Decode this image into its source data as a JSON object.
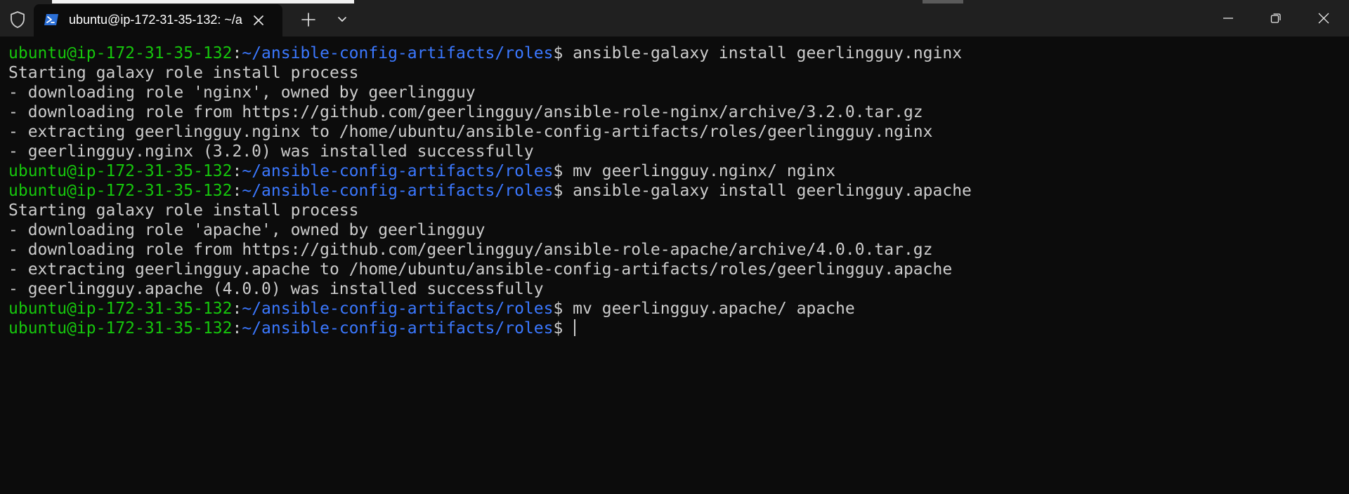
{
  "window": {
    "tab_title": "ubuntu@ip-172-31-35-132: ~/a",
    "controls": {
      "minimize": "minimize",
      "maximize": "restore",
      "close": "close"
    }
  },
  "icons": {
    "shield": "shield-icon",
    "tab": "powershell-icon",
    "tab_close": "close-icon",
    "new_tab": "plus-icon",
    "dropdown": "chevron-down-icon"
  },
  "colors": {
    "background": "#0c0c0c",
    "titlebar": "#202020",
    "prompt_user": "#16c60c",
    "prompt_path": "#3b78ff",
    "text": "#cccccc"
  },
  "terminal": {
    "lines": [
      {
        "type": "prompt",
        "user": "ubuntu@ip-172-31-35-132",
        "colon": ":",
        "path": "~/ansible-config-artifacts/roles",
        "symbol": "$",
        "command": " ansible-galaxy install geerlingguy.nginx"
      },
      {
        "type": "output",
        "text": "Starting galaxy role install process"
      },
      {
        "type": "output",
        "text": "- downloading role 'nginx', owned by geerlingguy"
      },
      {
        "type": "output",
        "text": "- downloading role from https://github.com/geerlingguy/ansible-role-nginx/archive/3.2.0.tar.gz"
      },
      {
        "type": "output",
        "text": "- extracting geerlingguy.nginx to /home/ubuntu/ansible-config-artifacts/roles/geerlingguy.nginx"
      },
      {
        "type": "output",
        "text": "- geerlingguy.nginx (3.2.0) was installed successfully"
      },
      {
        "type": "prompt",
        "user": "ubuntu@ip-172-31-35-132",
        "colon": ":",
        "path": "~/ansible-config-artifacts/roles",
        "symbol": "$",
        "command": " mv geerlingguy.nginx/ nginx"
      },
      {
        "type": "prompt",
        "user": "ubuntu@ip-172-31-35-132",
        "colon": ":",
        "path": "~/ansible-config-artifacts/roles",
        "symbol": "$",
        "command": " ansible-galaxy install geerlingguy.apache"
      },
      {
        "type": "output",
        "text": "Starting galaxy role install process"
      },
      {
        "type": "output",
        "text": "- downloading role 'apache', owned by geerlingguy"
      },
      {
        "type": "output",
        "text": "- downloading role from https://github.com/geerlingguy/ansible-role-apache/archive/4.0.0.tar.gz"
      },
      {
        "type": "output",
        "text": "- extracting geerlingguy.apache to /home/ubuntu/ansible-config-artifacts/roles/geerlingguy.apache"
      },
      {
        "type": "output",
        "text": "- geerlingguy.apache (4.0.0) was installed successfully"
      },
      {
        "type": "prompt",
        "user": "ubuntu@ip-172-31-35-132",
        "colon": ":",
        "path": "~/ansible-config-artifacts/roles",
        "symbol": "$",
        "command": " mv geerlingguy.apache/ apache"
      },
      {
        "type": "prompt",
        "user": "ubuntu@ip-172-31-35-132",
        "colon": ":",
        "path": "~/ansible-config-artifacts/roles",
        "symbol": "$",
        "command": " ",
        "cursor": true
      }
    ]
  }
}
